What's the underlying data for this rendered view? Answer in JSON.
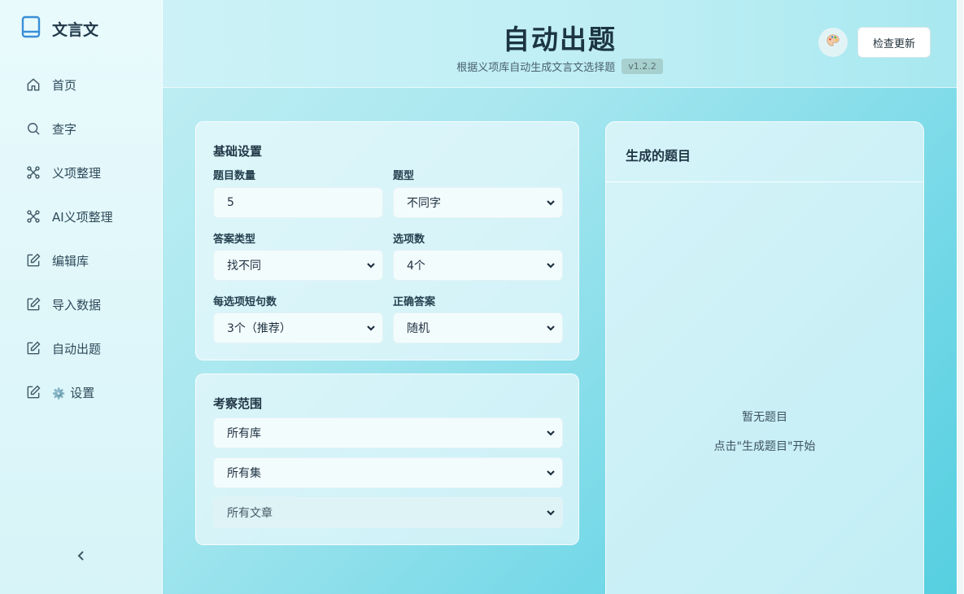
{
  "sidebar": {
    "brand": "文言文",
    "items": [
      {
        "label": "首页",
        "icon": "home-icon"
      },
      {
        "label": "查字",
        "icon": "search-icon"
      },
      {
        "label": "义项整理",
        "icon": "graph-icon"
      },
      {
        "label": "AI义项整理",
        "icon": "graph-icon"
      },
      {
        "label": "编辑库",
        "icon": "edit-icon"
      },
      {
        "label": "导入数据",
        "icon": "edit-icon"
      },
      {
        "label": "自动出题",
        "icon": "edit-icon"
      },
      {
        "label": "设置",
        "icon": "edit-icon",
        "prefix": "⚙️"
      }
    ]
  },
  "header": {
    "title": "自动出题",
    "subtitle": "根据义项库自动生成文言文选择题",
    "version": "v1.2.2",
    "update_label": "检查更新"
  },
  "basic": {
    "title": "基础设置",
    "count_label": "题目数量",
    "count_value": "5",
    "type_label": "题型",
    "type_value": "不同字",
    "answer_type_label": "答案类型",
    "answer_type_value": "找不同",
    "options_label": "选项数",
    "options_value": "4个",
    "clauses_label": "每选项短句数",
    "clauses_value": "3个（推荐）",
    "correct_label": "正确答案",
    "correct_value": "随机"
  },
  "scope": {
    "title": "考察范围",
    "library_value": "所有库",
    "collection_value": "所有集",
    "article_value": "所有文章"
  },
  "result": {
    "title": "生成的题目",
    "empty_line1": "暂无题目",
    "empty_line2": "点击\"生成题目\"开始"
  }
}
